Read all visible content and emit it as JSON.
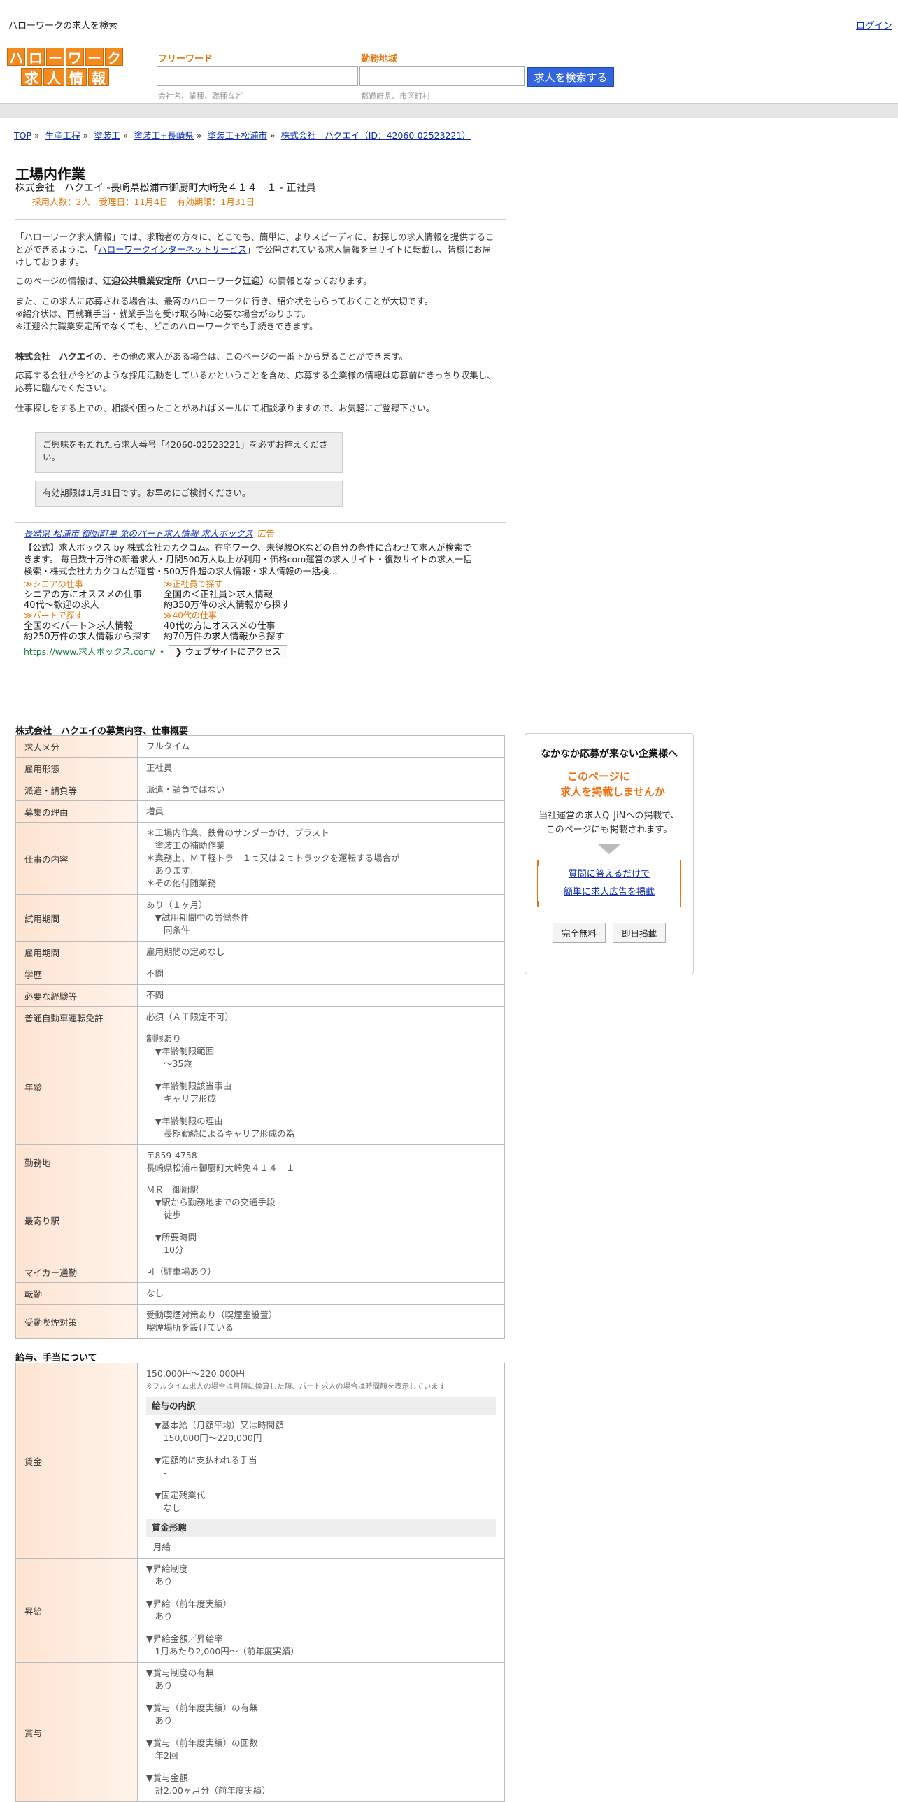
{
  "header": {
    "site_title": "ハローワークの求人を検索",
    "login": "ログイン"
  },
  "logo": {
    "row1": [
      "ハ",
      "ロ",
      "ー",
      "ワ",
      "ー",
      "ク"
    ],
    "row2": [
      "求",
      "人",
      "情",
      "報"
    ]
  },
  "search": {
    "freeword_label": "フリーワード",
    "freeword_hint": "会社名、業種、職種など",
    "area_label": "勤務地域",
    "area_hint": "都道府県、市区町村",
    "button": "求人を検索する"
  },
  "breadcrumb": [
    "TOP",
    "生産工程",
    "塗装工",
    "塗装工+長崎県",
    "塗装工+松浦市",
    "株式会社　ハクエイ（ID：42060-02523221）"
  ],
  "job": {
    "title": "工場内作業",
    "company_line": "株式会社　ハクエイ -長崎県松浦市御厨町大崎免４１４－１ - 正社員",
    "meta": "採用人数：2人　受理日：11月4日　有効期限：1月31日"
  },
  "intro": {
    "p1_before": "「ハローワーク求人情報」では、求職者の方々に、どこでも、簡単に、よりスピーディに、お探しの求人情報を提供することができるように、「",
    "p1_link": "ハローワークインターネットサービス",
    "p1_after": "」で公開されている求人情報を当サイトに転載し、皆様にお届けしております。",
    "p2_before": "このページの情報は、",
    "p2_bold": "江迎公共職業安定所（ハローワーク江迎）",
    "p2_after": "の情報となっております。",
    "p3": [
      "また、この求人に応募される場合は、最寄のハローワークに行き、紹介状をもらっておくことが大切です。",
      "※紹介状は、再就職手当・就業手当を受け取る時に必要な場合があります。",
      "※江迎公共職業安定所でなくても、どこのハローワークでも手続きできます。"
    ],
    "p4_bold": "株式会社　ハクエイ",
    "p4_after": "の、その他の求人がある場合は、このページの一番下から見ることができます。",
    "p5": "応募する会社が今どのような採用活動をしているかということを含め、応募する企業様の情報は応募前にきっちり収集し、応募に臨んでください。",
    "p6": "仕事探しをする上での、相談や困ったことがあればメールにて相談承りますので、お気軽にご登録下さい。"
  },
  "notices": [
    "ご興味をもたれたら求人番号「42060-02523221」を必ずお控えください。",
    "有効期限は1月31日です。お早めにご検討ください。"
  ],
  "ad": {
    "title": "長崎県 松浦市 御厨町里 免のパート求人情報 求人ボックス",
    "badge": "広告",
    "desc": "【公式】求人ボックス by 株式会社カカクコム。在宅ワーク、未経験OKなどの自分の条件に合わせて求人が検索できます。 毎日数十万件の新着求人・月間500万人以上が利用・価格com運営の求人サイト・複数サイトの求人一括検索・株式会社カカクコムが運営・500万件超の求人情報・求人情報の一括検…",
    "links": [
      {
        "link": "≫シニアの仕事",
        "l1": "シニアの方にオススメの仕事",
        "l2": "40代～歓迎の求人"
      },
      {
        "link": "≫正社員で探す",
        "l1": "全国の＜正社員＞求人情報",
        "l2": "約350万件の求人情報から探す"
      },
      {
        "link": "≫パートで探す",
        "l1": "全国の＜パート＞求人情報",
        "l2": "約250万件の求人情報から探す"
      },
      {
        "link": "≫40代の仕事",
        "l1": "40代の方にオススメの仕事",
        "l2": "約70万件の求人情報から探す"
      }
    ],
    "url": "https://www.求人ボックス.com/",
    "visit": "❯ ウェブサイトにアクセス"
  },
  "details": {
    "title": "株式会社　ハクエイの募集内容、仕事概要",
    "rows": [
      {
        "key": "求人区分",
        "lines": [
          "フルタイム"
        ]
      },
      {
        "key": "雇用形態",
        "lines": [
          "正社員"
        ]
      },
      {
        "key": "派遣・請負等",
        "lines": [
          "派遣・請負ではない"
        ]
      },
      {
        "key": "募集の理由",
        "lines": [
          "増員"
        ]
      },
      {
        "key": "仕事の内容",
        "lines": [
          "＊工場内作業、鉄骨のサンダーかけ、ブラスト",
          "　塗装工の補助作業",
          "＊業務上、ＭＴ軽トラ－１ｔ又は２ｔトラックを運転する場合が",
          "　あります。",
          "＊その他付随業務"
        ]
      },
      {
        "key": "試用期間",
        "lines": [
          "あり（１ヶ月）",
          "　▼試用期間中の労働条件",
          "　　同条件"
        ]
      },
      {
        "key": "雇用期間",
        "lines": [
          "雇用期間の定めなし"
        ]
      },
      {
        "key": "学歴",
        "lines": [
          "不問"
        ]
      },
      {
        "key": "必要な経験等",
        "lines": [
          "不問"
        ]
      },
      {
        "key": "普通自動車運転免許",
        "lines": [
          "必須（ＡＴ限定不可）"
        ]
      },
      {
        "key": "年齢",
        "lines": [
          "制限あり",
          "　▼年齢制限範囲",
          "　　〜35歳",
          "",
          "　▼年齢制限該当事由",
          "　　キャリア形成",
          "",
          "　▼年齢制限の理由",
          "　　長期勤続によるキャリア形成の為"
        ]
      },
      {
        "key": "勤務地",
        "lines": [
          "〒859-4758",
          "長崎県松浦市御厨町大崎免４１４－１"
        ]
      },
      {
        "key": "最寄り駅",
        "lines": [
          "ＭＲ　御厨駅",
          "　▼駅から勤務地までの交通手段",
          "　　徒歩",
          "",
          "　▼所要時間",
          "　　10分"
        ]
      },
      {
        "key": "マイカー通勤",
        "lines": [
          "可（駐車場あり）"
        ]
      },
      {
        "key": "転勤",
        "lines": [
          "なし"
        ]
      },
      {
        "key": "受動喫煙対策",
        "lines": [
          "受動喫煙対策あり（喫煙室設置）",
          "喫煙場所を設けている"
        ]
      }
    ]
  },
  "salary": {
    "title": "給与、手当について",
    "wage_key": "賃金",
    "wage_range": "150,000円〜220,000円",
    "wage_note": "※フルタイム求人の場合は月額に換算した額、パート求人の場合は時間額を表示しています",
    "breakdown_head": "給与の内訳",
    "breakdown_lines": [
      "▼基本給（月額平均）又は時間額",
      "　150,000円〜220,000円",
      "",
      "▼定額的に支払われる手当",
      "　-",
      "",
      "▼固定残業代",
      "　なし"
    ],
    "form_head": "賃金形態",
    "form_value": "月給",
    "rows": [
      {
        "key": "昇給",
        "lines": [
          "▼昇給制度",
          "　あり",
          "",
          "▼昇給（前年度実績）",
          "　あり",
          "",
          "▼昇給金額／昇給率",
          "　1月あたり2,000円〜（前年度実績）"
        ]
      },
      {
        "key": "賞与",
        "lines": [
          "▼賞与制度の有無",
          "　あり",
          "",
          "▼賞与（前年度実績）の有無",
          "　あり",
          "",
          "▼賞与（前年度実績）の回数",
          "　年2回",
          "",
          "▼賞与金額",
          "　計2.00ヶ月分（前年度実績）"
        ]
      }
    ]
  },
  "sidebar": {
    "heading": "なかなか応募が来ない企業様へ",
    "offer1": "このページに",
    "offer2": "求人を掲載しませんか",
    "text1": "当社運営の求人Q-JiNへの掲載で、",
    "text2": "このページにも掲載されます。",
    "link1": "質問に答えるだけで",
    "link2": "簡単に求人広告を掲載",
    "btn1": "完全無料",
    "btn2": "即日掲載"
  },
  "colors": {
    "accent_orange": "#f28a1e",
    "button_blue": "#3366dd"
  }
}
